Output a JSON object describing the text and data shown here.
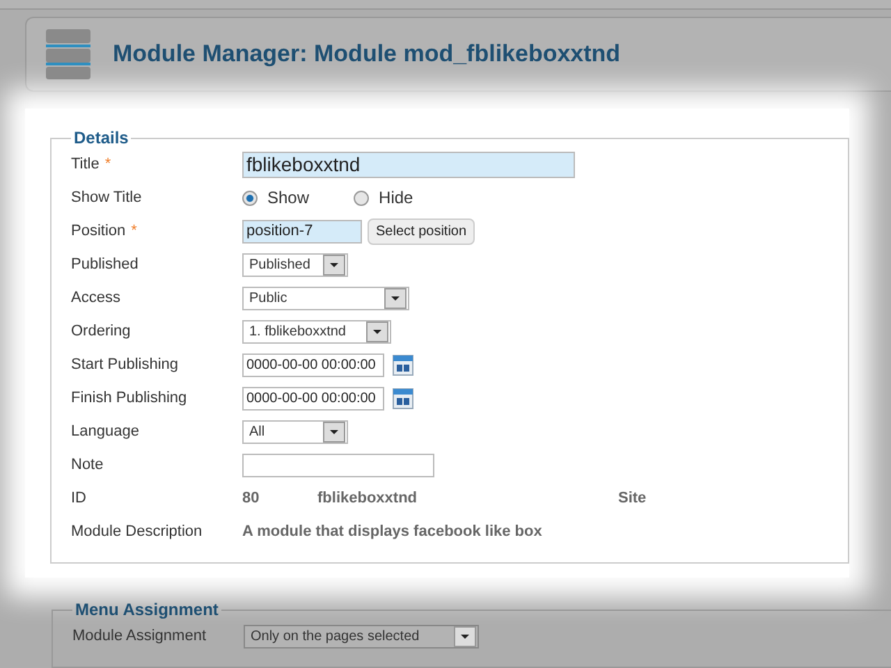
{
  "header": {
    "title": "Module Manager: Module mod_fblikeboxxtnd"
  },
  "details": {
    "legend": "Details",
    "fields": [
      {
        "kind": "text",
        "label": "Title",
        "mark": "*",
        "value": "fblikeboxxtnd",
        "highlighted": true
      },
      {
        "kind": "radio",
        "label": "Show Title",
        "options": [
          {
            "label": "Show",
            "selected": true
          },
          {
            "label": "Hide",
            "selected": false
          }
        ]
      },
      {
        "kind": "text",
        "label": "Position",
        "mark": "*",
        "value": "position-7",
        "highlighted": true,
        "button": "Select position"
      },
      {
        "kind": "select",
        "label": "Published",
        "value": "Published"
      },
      {
        "kind": "select",
        "label": "Access",
        "value": "Public"
      },
      {
        "kind": "select",
        "label": "Ordering",
        "value": "1. fblikeboxxtnd"
      },
      {
        "kind": "date",
        "label": "Start Publishing",
        "value": "0000-00-00 00:00:00"
      },
      {
        "kind": "date",
        "label": "Finish Publishing",
        "value": "0000-00-00 00:00:00"
      },
      {
        "kind": "select",
        "label": "Language",
        "value": "All"
      },
      {
        "kind": "text",
        "label": "Note",
        "highlighted": false
      },
      {
        "kind": "info",
        "label": "ID",
        "values": [
          "80",
          "fblikeboxxtnd",
          "Site"
        ]
      },
      {
        "kind": "description",
        "label": "Module Description",
        "value": "A module that displays facebook like box"
      }
    ]
  },
  "menu_assignment": {
    "legend": "Menu Assignment",
    "fields": [
      {
        "kind": "select",
        "label": "Module Assignment",
        "value": "Only on the pages selected"
      }
    ]
  }
}
